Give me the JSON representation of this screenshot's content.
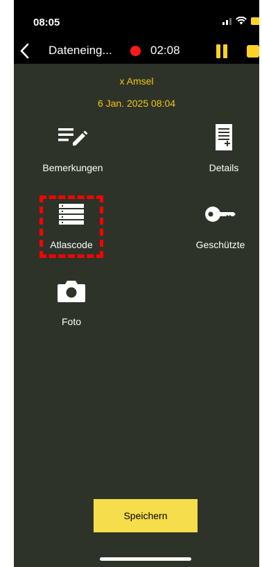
{
  "status_bar": {
    "time": "08:05"
  },
  "nav": {
    "title": "Dateneing...",
    "timer": "02:08"
  },
  "record": {
    "species": "x Amsel",
    "datetime": "6 Jan. 2025 08:04"
  },
  "tiles": [
    {
      "label": "Bemerkungen",
      "icon": "edit-notes-icon"
    },
    {
      "label": "Details",
      "icon": "document-icon"
    },
    {
      "label": "Atlascode",
      "icon": "list-icon"
    },
    {
      "label": "Geschützte",
      "icon": "key-icon"
    },
    {
      "label": "Foto",
      "icon": "camera-icon"
    }
  ],
  "save_button": {
    "label": "Speichern"
  },
  "colors": {
    "background": "#2d3328",
    "accent_text": "#f5c518",
    "save_button": "#f5dd4b",
    "record_dot": "#ff1a1a",
    "highlight": "#ff0000"
  }
}
